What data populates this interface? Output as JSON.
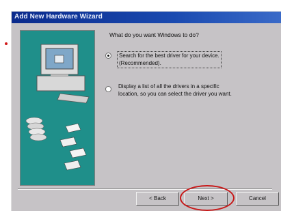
{
  "window": {
    "title": "Add New Hardware Wizard"
  },
  "main": {
    "question": "What do you want Windows to do?",
    "options": [
      {
        "line1": "Search for the best driver for your device.",
        "line2": "(Recommended).",
        "selected": true
      },
      {
        "line1": "Display a list of all the drivers in a specific",
        "line2": "location, so you can select the driver you want.",
        "selected": false
      }
    ]
  },
  "buttons": {
    "back": "< Back",
    "next": "Next >",
    "cancel": "Cancel"
  },
  "colors": {
    "titlebar": "#0a2a8c",
    "dialog": "#c6c3c6",
    "art_panel": "#1f8f8a",
    "highlight_ring": "#c81818"
  },
  "icons": [
    "computer-icon",
    "disc-stack-icon",
    "floppy-disk-icon"
  ]
}
